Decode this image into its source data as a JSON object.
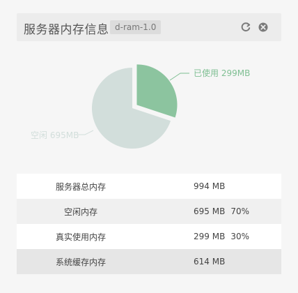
{
  "header": {
    "title": "服务器内存信息",
    "tag": "d-ram-1.0"
  },
  "chart_data": {
    "type": "pie",
    "title": "",
    "slices": [
      {
        "label": "已使用",
        "value": 299,
        "unit": "MB",
        "color": "#8cc49f",
        "exploded": true
      },
      {
        "label": "空闲",
        "value": 695,
        "unit": "MB",
        "color": "#d2dedb",
        "exploded": false
      }
    ],
    "labels": {
      "used": "已使用 299MB",
      "free": "空闲 695MB"
    },
    "label_colors": {
      "used": "#7fbf93",
      "free": "#d2dedb"
    }
  },
  "table": {
    "rows": [
      {
        "key": "服务器总内存",
        "value": "994 MB",
        "percent": ""
      },
      {
        "key": "空闲内存",
        "value": "695 MB",
        "percent": "70%"
      },
      {
        "key": "真实使用内存",
        "value": "299 MB",
        "percent": "30%"
      },
      {
        "key": "系统缓存内存",
        "value": "614 MB",
        "percent": ""
      }
    ]
  },
  "icons": {
    "refresh": "refresh-icon",
    "close": "close-icon"
  },
  "colors": {
    "used": "#8cc49f",
    "free": "#d2dedb",
    "icon": "#7a7a7a"
  }
}
